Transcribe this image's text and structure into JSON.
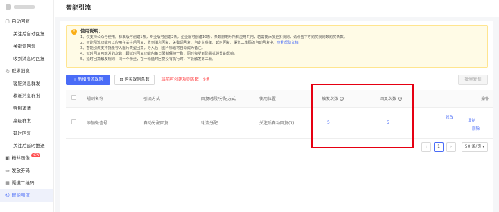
{
  "sidebar": {
    "items": [
      {
        "label": "自动回复",
        "icon": "chat-icon",
        "group": true
      },
      {
        "label": "关注后自动回复"
      },
      {
        "label": "关键词回复"
      },
      {
        "label": "收到消息时回复"
      },
      {
        "label": "群发消息",
        "icon": "group-message-icon",
        "group": true
      },
      {
        "label": "客服消息群发"
      },
      {
        "label": "模板消息群发"
      },
      {
        "label": "强制邀请"
      },
      {
        "label": "高级群发"
      },
      {
        "label": "延时回复"
      },
      {
        "label": "关注后延时推送"
      },
      {
        "label": "粉丝画像",
        "icon": "fans-icon",
        "group": true,
        "badge": "NEW"
      },
      {
        "label": "发放券码",
        "icon": "coupon-icon",
        "group": true
      },
      {
        "label": "渠道二维码",
        "icon": "qrcode-icon",
        "group": true
      },
      {
        "label": "智能引流",
        "icon": "user-icon",
        "group": true,
        "active": true
      }
    ]
  },
  "page": {
    "title": "智能引流"
  },
  "notice": {
    "title": "使用说明：",
    "lines": [
      "1、仅支持公众号使用。标准版可创建1条，专业版可创建2条，企业版可创建10条，条数限制为所有应用共用，若需要添加更多规则，请点击下方购买规则数购买条数。",
      "2、智能引流功能可以应用在关注后回复、收到消息回复、关键词回复、自定义菜单、延时回复、渠道二维码的自动回复中。",
      "3、智能引流支持批量导入图片类型回复，导入后，图片标题将自动成为备注。",
      "4、延时回复可触发的次数，跟延时回复功能内每日限制保持一致，同时会受到防骚扰设置的影响。",
      "5、延时回复触发规则：同一个粉丝，在一轮延时回复没有执行时，不会触发第二轮。"
    ],
    "help_link": "查看帮助文档"
  },
  "toolbar": {
    "add_label": "+ 新增引流规则",
    "buy_label": "购买规则条数",
    "quota_text": "当前可创建规则条数：9条",
    "batch_label": "批量复制"
  },
  "table": {
    "headers": [
      "规则名称",
      "引流方式",
      "回复时段/分配方式",
      "使用位置",
      "触发次数",
      "回复次数",
      "操作"
    ],
    "rows": [
      {
        "name": "添加微信号",
        "method": "自动分配回复",
        "allocation": "轮流分配",
        "position": "关注后自动回复(1)",
        "trigger_count": "5",
        "reply_count": "5",
        "actions": [
          "修改",
          "复制",
          "删除"
        ]
      }
    ]
  },
  "pagination": {
    "current_page": "1",
    "page_size": "50 条/页"
  },
  "colors": {
    "accent": "#4a6cf7",
    "highlight": "#e60012",
    "notice_bg": "#fffbe6"
  }
}
